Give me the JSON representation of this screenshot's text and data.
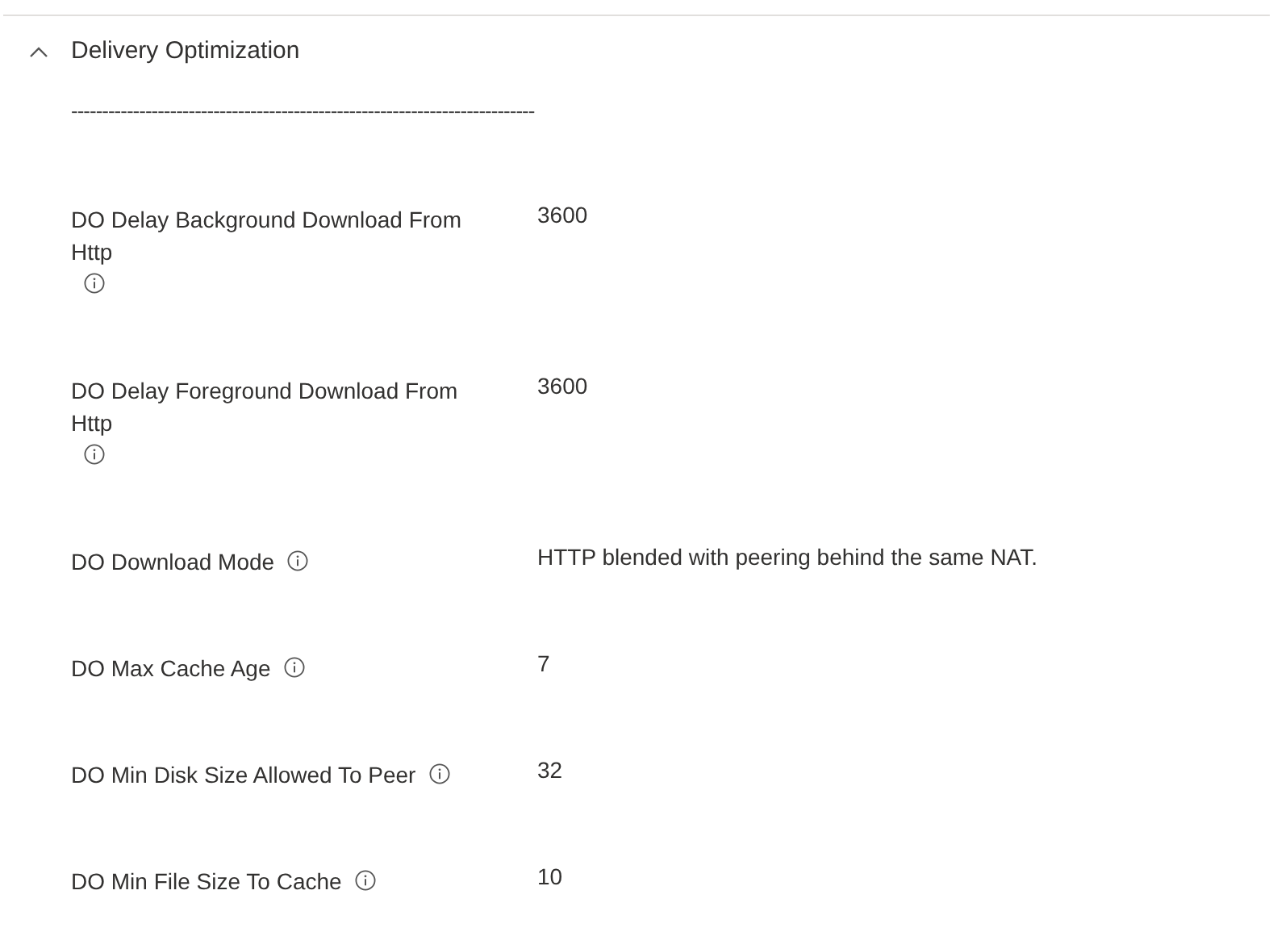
{
  "section": {
    "title": "Delivery Optimization",
    "expanded": true,
    "separator": "---------------------------------------------------------------------------",
    "settings": [
      {
        "label": "DO Delay Background Download From Http",
        "value": "3600"
      },
      {
        "label": "DO Delay Foreground Download From Http",
        "value": "3600"
      },
      {
        "label": "DO Download Mode",
        "value": "HTTP blended with peering behind the same NAT."
      },
      {
        "label": "DO Max Cache Age",
        "value": "7"
      },
      {
        "label": "DO Min Disk Size Allowed To Peer",
        "value": "32"
      },
      {
        "label": "DO Min File Size To Cache",
        "value": "10"
      }
    ]
  }
}
